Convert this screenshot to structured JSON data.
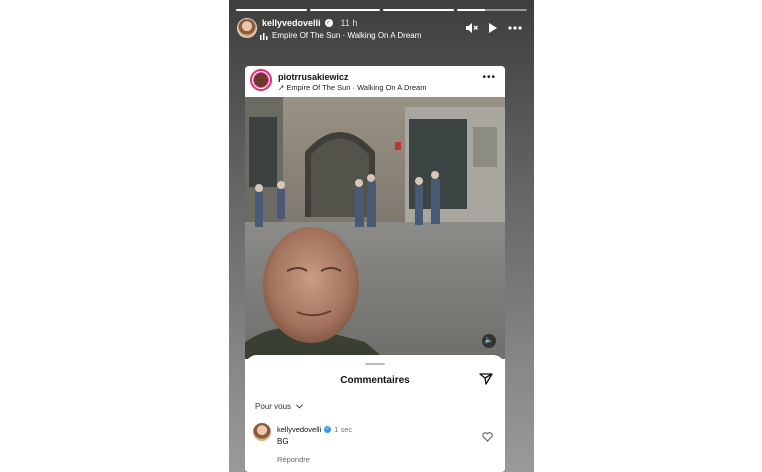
{
  "story": {
    "username": "kellyvedovelli",
    "time": "11 h",
    "music": "Empire Of The Sun · Walking On A Dream",
    "progress_segments": 4,
    "icons": [
      "muted-speaker-icon",
      "play-icon",
      "more-icon"
    ]
  },
  "post": {
    "username": "piotrrusakiewicz",
    "music": "Empire Of The Sun · Walking On A Dream",
    "more": "•••"
  },
  "comments": {
    "title": "Commentaires",
    "sort_label": "Pour vous",
    "items": [
      {
        "username": "kellyvedovelli",
        "time": "1 sec",
        "text": "BG",
        "reply_label": "Répondre"
      }
    ]
  }
}
